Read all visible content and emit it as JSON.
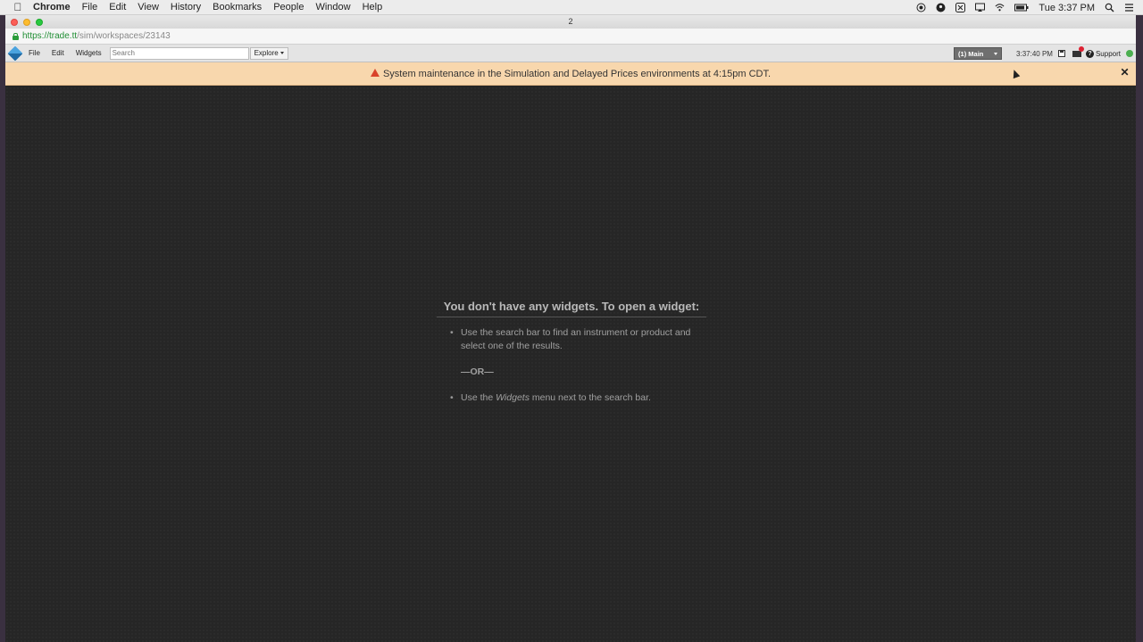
{
  "mac_menubar": {
    "app_name": "Chrome",
    "items": [
      "File",
      "Edit",
      "View",
      "History",
      "Bookmarks",
      "People",
      "Window",
      "Help"
    ],
    "clock": "Tue 3:37 PM"
  },
  "browser": {
    "window_title": "2",
    "url_secure": "https://trade.tt",
    "url_path": "/sim/workspaces/23143"
  },
  "app_toolbar": {
    "menus": [
      "File",
      "Edit",
      "Widgets"
    ],
    "search_placeholder": "Search",
    "explore_label": "Explore",
    "workspace_label": "(1) Main",
    "time": "3:37:40 PM",
    "support_label": "Support",
    "help_glyph": "?"
  },
  "banner": {
    "message": "System maintenance in the Simulation and Delayed Prices environments at 4:15pm CDT.",
    "close_glyph": "✕",
    "color": "#f8d7ad"
  },
  "empty_state": {
    "title": "You don't have any widgets. To open a widget:",
    "item1": "Use the search bar to find an instrument or product and select one of the results.",
    "or_label": "—OR—",
    "item2_prefix": "Use the ",
    "item2_em": "Widgets",
    "item2_suffix": " menu next to the search bar."
  }
}
